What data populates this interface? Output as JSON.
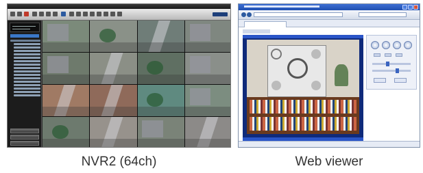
{
  "captions": {
    "nvr": "NVR2 (64ch)",
    "web": "Web viewer"
  },
  "nvr": {
    "tile_colors": [
      "#7b8a7a",
      "#8a9188",
      "#6f7d78",
      "#7f8780",
      "#6e7a6c",
      "#8b8f86",
      "#5f6f62",
      "#8a8f8a",
      "#a07a64",
      "#8f6a5a",
      "#5f8a80",
      "#7c8d80",
      "#6d7a6e",
      "#97928c",
      "#7a8378",
      "#8c8a88"
    ],
    "tile_types": [
      "bldg",
      "tree",
      "road",
      "bldg",
      "bldg",
      "road",
      "tree",
      "bldg",
      "road",
      "road",
      "tree",
      "bldg",
      "tree",
      "road",
      "bldg",
      "road"
    ]
  }
}
